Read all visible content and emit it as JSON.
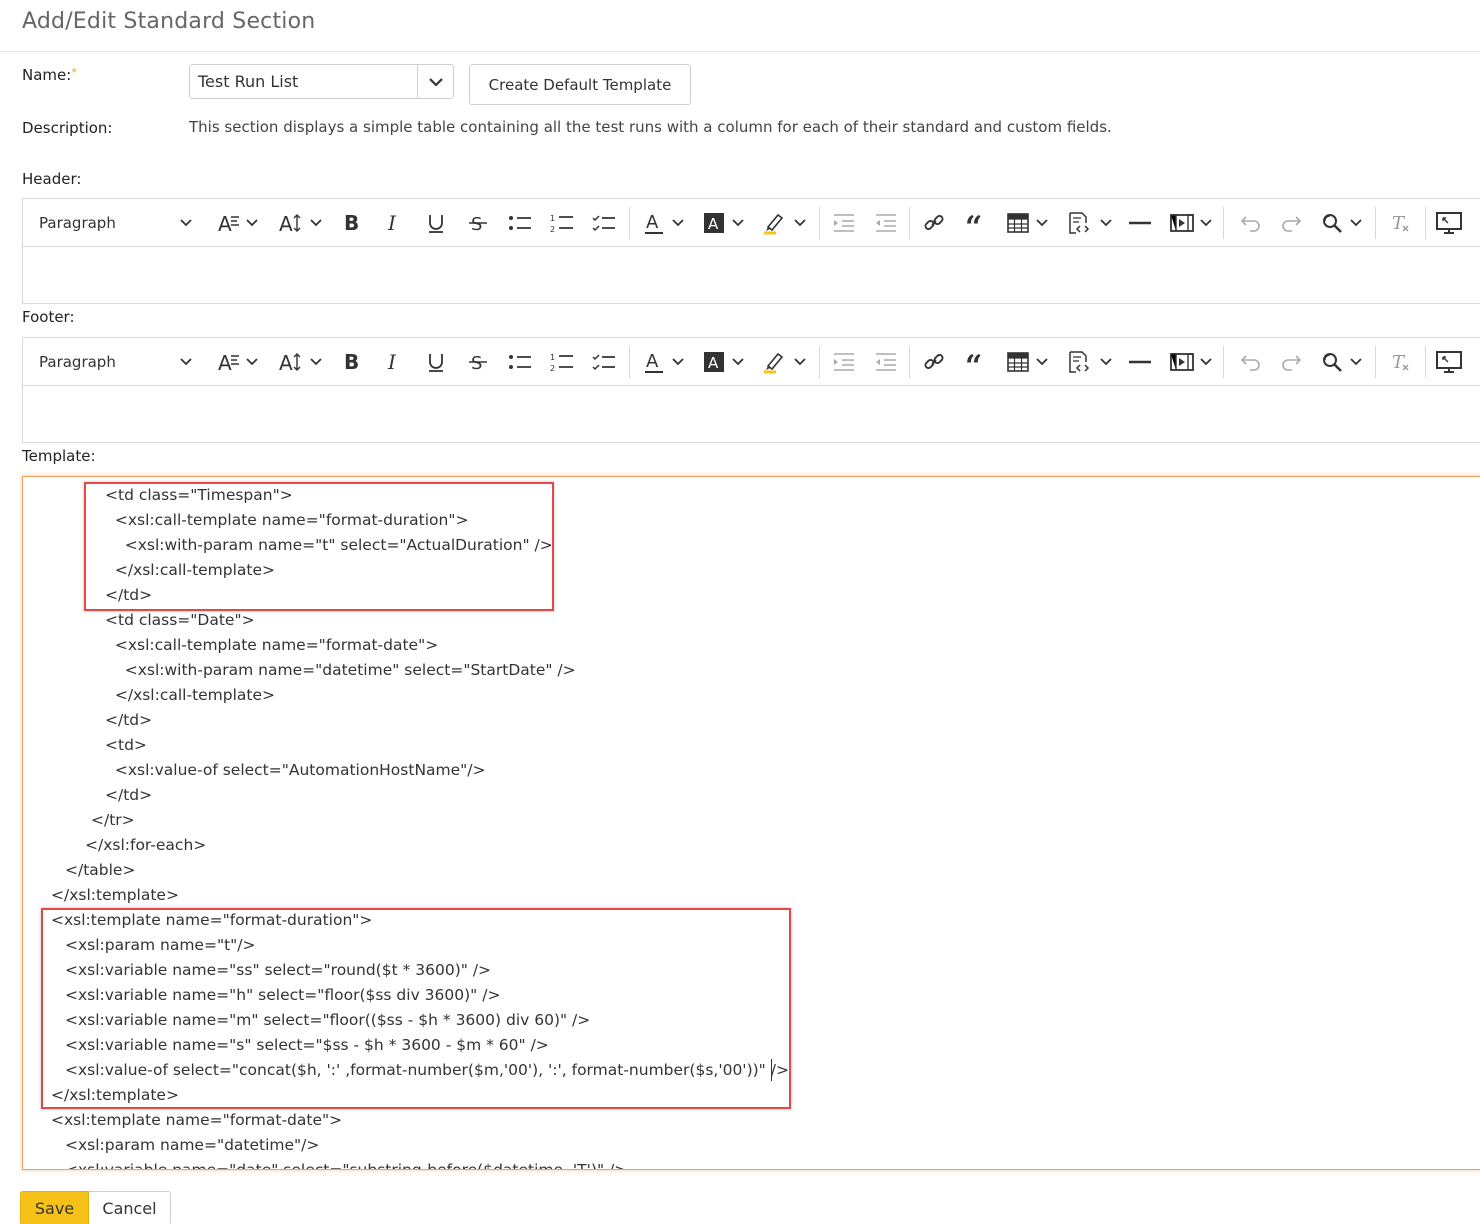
{
  "page": {
    "title": "Add/Edit Standard Section"
  },
  "form": {
    "name_label": "Name:",
    "required_marker": "*",
    "name_value": "Test Run List",
    "create_template_label": "Create Default Template",
    "description_label": "Description:",
    "description_text": "This section displays a simple table containing all the test runs with a column for each of their standard and custom fields.",
    "header_label": "Header:",
    "footer_label": "Footer:",
    "template_label": "Template:"
  },
  "toolbar": {
    "paragraph_label": "Paragraph",
    "icons": [
      "font-style-icon",
      "font-size-icon",
      "bold-icon",
      "italic-icon",
      "underline-icon",
      "strikethrough-icon",
      "bulleted-list-icon",
      "numbered-list-icon",
      "todo-list-icon",
      "font-color-icon",
      "background-color-icon",
      "highlight-icon",
      "indent-icon",
      "outdent-icon",
      "link-icon",
      "blockquote-icon",
      "table-icon",
      "source-code-icon",
      "horizontal-line-icon",
      "media-embed-icon",
      "undo-icon",
      "redo-icon",
      "find-replace-icon",
      "remove-format-icon",
      "fullscreen-icon"
    ]
  },
  "template_code": [
    "<td class=\"Timespan\">",
    "  <xsl:call-template name=\"format-duration\">",
    "    <xsl:with-param name=\"t\" select=\"ActualDuration\" />",
    "  </xsl:call-template>",
    "</td>",
    "<td class=\"Date\">",
    "  <xsl:call-template name=\"format-date\">",
    "    <xsl:with-param name=\"datetime\" select=\"StartDate\" />",
    "  </xsl:call-template>",
    "</td>",
    "<td>",
    "  <xsl:value-of select=\"AutomationHostName\"/>",
    "</td>",
    "</tr>",
    "</xsl:for-each>",
    "</table>",
    "</xsl:template>",
    "<xsl:template name=\"format-duration\">",
    "<xsl:param name=\"t\"/>",
    "<xsl:variable name=\"ss\" select=\"round($t * 3600)\" />",
    "<xsl:variable name=\"h\" select=\"floor($ss div 3600)\" />",
    "<xsl:variable name=\"m\" select=\"floor(($ss - $h * 3600) div 60)\" />",
    "<xsl:variable name=\"s\" select=\"$ss - $h * 3600 - $m * 60\" />",
    "<xsl:value-of select=\"concat($h, ':' ,format-number($m,'00'), ':', format-number($s,'00'))\" />",
    "</xsl:template>",
    "<xsl:template name=\"format-date\">",
    "<xsl:param name=\"datetime\"/>",
    "<xsl:variable name=\"date\" select=\"substring-before($datetime, 'T')\" />"
  ],
  "buttons": {
    "save": "Save",
    "cancel": "Cancel"
  },
  "colors": {
    "accent": "#f6c21a",
    "required_star": "#f0a020",
    "highlight_box": "#e24a4a",
    "focus_border": "#f0a060"
  }
}
